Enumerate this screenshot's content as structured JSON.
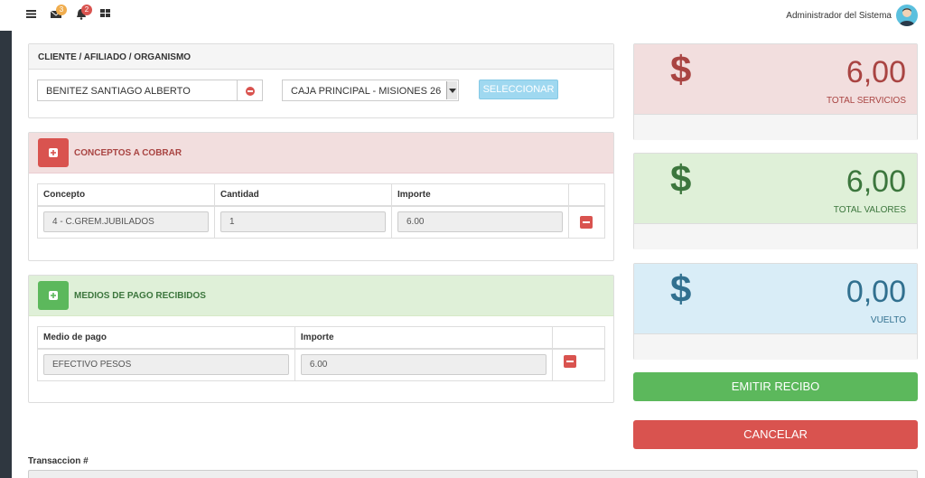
{
  "header": {
    "mail_badge": "3",
    "bell_badge": "2",
    "user_name": "Administrador del Sistema"
  },
  "client_panel": {
    "title": "CLIENTE / AFILIADO / ORGANISMO",
    "client_value": "BENITEZ SANTIAGO ALBERTO",
    "caja_value": "CAJA PRINCIPAL - MISIONES 26",
    "select_label": "SELECCIONAR"
  },
  "conceptos": {
    "title": "CONCEPTOS A COBRAR",
    "columns": [
      "Concepto",
      "Cantidad",
      "Importe"
    ],
    "rows": [
      {
        "concepto": "4 - C.GREM.JUBILADOS",
        "cantidad": "1",
        "importe": "6.00"
      }
    ]
  },
  "medios": {
    "title": "MEDIOS DE PAGO RECIBIDOS",
    "columns": [
      "Medio de pago",
      "Importe"
    ],
    "rows": [
      {
        "medio": "EFECTIVO PESOS",
        "importe": "6.00"
      }
    ]
  },
  "stats": {
    "servicios": {
      "value": "6,00",
      "label": "TOTAL SERVICIOS",
      "color": "#a94442",
      "bg": "#f2dede"
    },
    "valores": {
      "value": "6,00",
      "label": "TOTAL VALORES",
      "color": "#3c763d",
      "bg": "#dff0d8"
    },
    "vuelto": {
      "value": "0,00",
      "label": "VUELTO",
      "color": "#31708f",
      "bg": "#d9edf7"
    },
    "currency_symbol": "$"
  },
  "actions": {
    "emit_label": "EMITIR RECIBO",
    "cancel_label": "CANCELAR"
  },
  "transaction": {
    "label": "Transaccion #"
  },
  "colors": {
    "success": "#5cb85c",
    "danger": "#d9534f"
  }
}
